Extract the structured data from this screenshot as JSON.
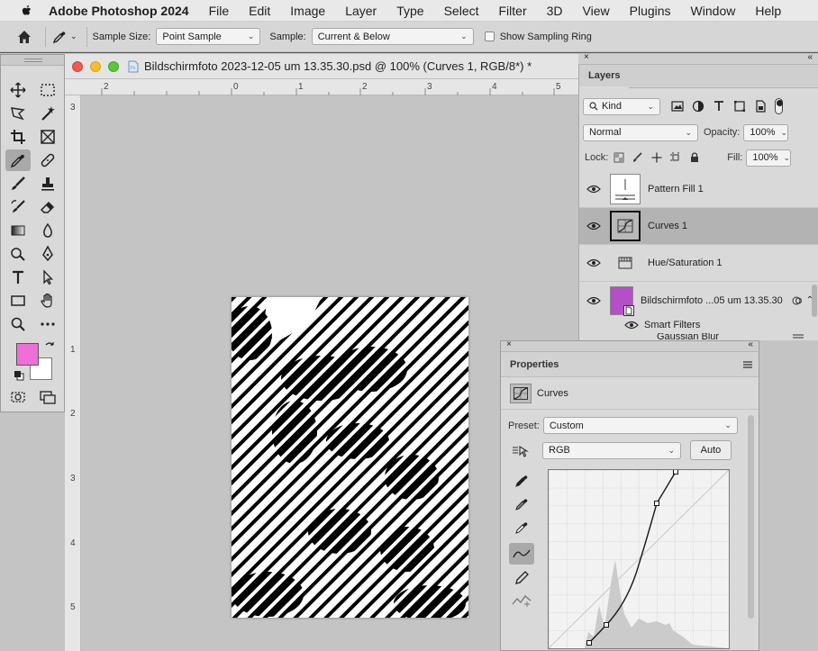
{
  "menubar": {
    "app_name": "Adobe Photoshop 2024",
    "items": [
      "File",
      "Edit",
      "Image",
      "Layer",
      "Type",
      "Select",
      "Filter",
      "3D",
      "View",
      "Plugins",
      "Window",
      "Help"
    ]
  },
  "options_bar": {
    "sample_size_label": "Sample Size:",
    "sample_size_value": "Point Sample",
    "sample_label": "Sample:",
    "sample_value": "Current & Below",
    "sampling_ring_label": "Show Sampling Ring",
    "sampling_ring_checked": false
  },
  "toolbox": {
    "foreground_color": "#ee6fd6",
    "background_color": "#ffffff"
  },
  "document": {
    "title": "Bildschirmfoto 2023-12-05 um 13.35.30.psd @ 100% (Curves 1, RGB/8*) *",
    "ruler_h_labels": [
      "2",
      "0",
      "1",
      "2",
      "3",
      "4",
      "5"
    ],
    "ruler_v_labels": [
      "3",
      "1",
      "2",
      "3",
      "4",
      "5"
    ]
  },
  "layers_panel": {
    "tab_label": "Layers",
    "filter_kind": "Kind",
    "blend_mode": "Normal",
    "opacity_label": "Opacity:",
    "opacity_value": "100%",
    "lock_label": "Lock:",
    "fill_label": "Fill:",
    "fill_value": "100%",
    "layers": [
      {
        "name": "Pattern Fill 1",
        "visible": true,
        "selected": false
      },
      {
        "name": "Curves 1",
        "visible": true,
        "selected": true
      },
      {
        "name": "Hue/Saturation 1",
        "visible": true,
        "selected": false
      },
      {
        "name": "Bildschirmfoto ...05 um 13.35.30",
        "visible": true,
        "selected": false
      }
    ],
    "smart_filters_label": "Smart Filters",
    "smart_filter_item": "Gaussian Blur"
  },
  "properties_panel": {
    "tab_label": "Properties",
    "adjustment_name": "Curves",
    "preset_label": "Preset:",
    "preset_value": "Custom",
    "channel_value": "RGB",
    "auto_label": "Auto"
  }
}
